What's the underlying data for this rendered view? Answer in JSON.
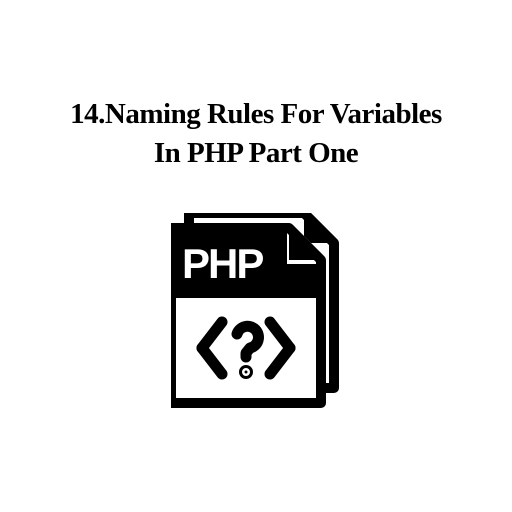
{
  "title": {
    "line1": "14.Naming Rules For Variables",
    "line2": "In PHP Part One"
  },
  "icon": {
    "headerText": "PHP",
    "bodySymbol": "<?>"
  }
}
